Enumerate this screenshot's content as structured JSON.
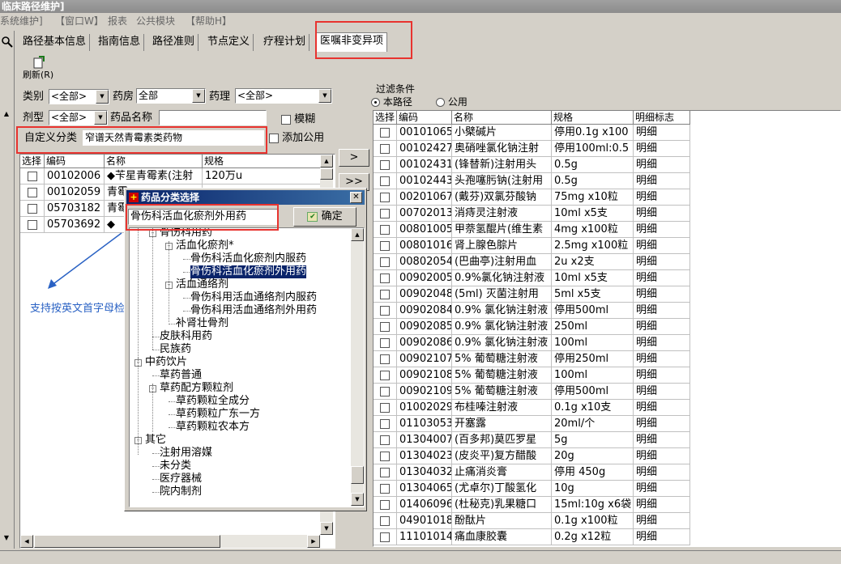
{
  "window": {
    "title": "临床路径维护]"
  },
  "menu": [
    "系统维护]",
    "【窗口W】",
    "报表",
    "公共模块",
    "【帮助H】"
  ],
  "tabs": [
    "路径基本信息",
    "指南信息",
    "路径准则",
    "节点定义",
    "疗程计划",
    "医嘱非变异项"
  ],
  "toolbar": {
    "refresh_label": "刷新(R)"
  },
  "filters": {
    "category_label": "类别",
    "category_value": "<全部>",
    "pharmacy_label": "药房",
    "pharmacy_value": "全部",
    "pharmacology_label": "药理",
    "pharmacology_value": "<全部>",
    "dosage_label": "剂型",
    "dosage_value": "<全部>",
    "drug_name_label": "药品名称",
    "drug_name_value": "",
    "fuzzy_label": "模糊",
    "custom_category_label": "自定义分类",
    "custom_category_value": "窄谱天然青霉素类药物",
    "add_public_label": "添加公用"
  },
  "left_grid": {
    "columns": [
      "选择",
      "编码",
      "名称",
      "规格"
    ],
    "rows": [
      [
        "00102006",
        "◆苄星青霉素(注射",
        "120万u"
      ],
      [
        "00102059",
        "青霉",
        "",
        ""
      ],
      [
        "05703182",
        "青霉",
        "",
        ""
      ],
      [
        "05703692",
        "◆",
        "",
        ""
      ]
    ]
  },
  "move_buttons": [
    ">",
    ">>"
  ],
  "note": "支持按英文首字母检索",
  "dialog": {
    "title": "药品分类选择",
    "selected_value": "骨伤科活血化瘀剂外用药",
    "ok_label": "确定",
    "tree": [
      {
        "label": "骨伤科用药",
        "level": 1,
        "sign": "-"
      },
      {
        "label": "活血化瘀剂*",
        "level": 2,
        "sign": "-"
      },
      {
        "label": "骨伤科活血化瘀剂内服药",
        "level": 3
      },
      {
        "label": "骨伤科活血化瘀剂外用药",
        "level": 3,
        "selected": true
      },
      {
        "label": "活血通络剂",
        "level": 2,
        "sign": "-"
      },
      {
        "label": "骨伤科用活血通络剂内服药",
        "level": 3
      },
      {
        "label": "骨伤科用活血通络剂外用药",
        "level": 3
      },
      {
        "label": "补肾壮骨剂",
        "level": 2
      },
      {
        "label": "皮肤科用药",
        "level": 1
      },
      {
        "label": "民族药",
        "level": 1
      },
      {
        "label": "中药饮片",
        "level": 0,
        "sign": "-"
      },
      {
        "label": "草药普通",
        "level": 1
      },
      {
        "label": "草药配方颗粒剂",
        "level": 1,
        "sign": "-"
      },
      {
        "label": "草药颗粒全成分",
        "level": 2
      },
      {
        "label": "草药颗粒广东一方",
        "level": 2
      },
      {
        "label": "草药颗粒农本方",
        "level": 2
      },
      {
        "label": "其它",
        "level": 0,
        "sign": "-"
      },
      {
        "label": "注射用溶媒",
        "level": 1
      },
      {
        "label": "未分类",
        "level": 1
      },
      {
        "label": "医疗器械",
        "level": 1
      },
      {
        "label": "院内制剂",
        "level": 1
      }
    ]
  },
  "right_panel": {
    "group_title": "过滤条件",
    "radio_this": "本路径",
    "radio_public": "公用",
    "columns": [
      "选择",
      "编码",
      "名称",
      "规格",
      "明细标志"
    ],
    "rows": [
      [
        "00101065",
        "小檗碱片",
        "停用0.1g x100",
        "明细"
      ],
      [
        "00102427",
        "奥硝唑氯化钠注射",
        "停用100ml:0.5",
        "明细"
      ],
      [
        "00102431",
        "(锋替新)注射用头",
        "0.5g",
        "明细"
      ],
      [
        "00102443",
        "头孢噻肟钠(注射用",
        "0.5g",
        "明细"
      ],
      [
        "00201067",
        "(戴芬)双氯芬酸钠",
        "75mg x10粒",
        "明细"
      ],
      [
        "00702013",
        "消痔灵注射液",
        "10ml x5支",
        "明细"
      ],
      [
        "00801005",
        "甲萘氢醌片(维生素",
        "4mg x100粒",
        "明细"
      ],
      [
        "00801016",
        "肾上腺色腙片",
        "2.5mg x100粒",
        "明细"
      ],
      [
        "00802054",
        "(巴曲亭)注射用血",
        "2u x2支",
        "明细"
      ],
      [
        "00902005",
        "0.9%氯化钠注射液",
        "10ml x5支",
        "明细"
      ],
      [
        "00902048",
        "(5ml) 灭菌注射用",
        "5ml x5支",
        "明细"
      ],
      [
        "00902084",
        "0.9% 氯化钠注射液",
        "停用500ml",
        "明细"
      ],
      [
        "00902085",
        "0.9% 氯化钠注射液",
        "250ml",
        "明细"
      ],
      [
        "00902086",
        "0.9% 氯化钠注射液",
        "100ml",
        "明细"
      ],
      [
        "00902107",
        "5% 葡萄糖注射液",
        "停用250ml",
        "明细"
      ],
      [
        "00902108",
        "5% 葡萄糖注射液",
        "100ml",
        "明细"
      ],
      [
        "00902109",
        "5% 葡萄糖注射液",
        "停用500ml",
        "明细"
      ],
      [
        "01002029",
        "布桂嗪注射液",
        "0.1g x10支",
        "明细"
      ],
      [
        "01103053",
        "开塞露",
        "20ml/个",
        "明细"
      ],
      [
        "01304007",
        "(百多邦)莫匹罗星",
        "5g",
        "明细"
      ],
      [
        "01304023",
        "(皮炎平)复方醋酸",
        "20g",
        "明细"
      ],
      [
        "01304032",
        "止痛消炎膏",
        "停用 450g",
        "明细"
      ],
      [
        "01304065",
        "(尤卓尔)丁酸氢化",
        "10g",
        "明细"
      ],
      [
        "01406096",
        "(杜秘克)乳果糖口",
        "15ml:10g x6袋",
        "明细"
      ],
      [
        "04901018",
        "酚酞片",
        "0.1g x100粒",
        "明细"
      ],
      [
        "11101014",
        "痛血康胶囊",
        "0.2g x12粒",
        "明细"
      ]
    ]
  },
  "colors": {
    "annotation_red": "#e8332f",
    "note_blue": "#2a62c4",
    "dialog_title_bg": "#0a246a",
    "selected_bg": "#0a246a"
  }
}
